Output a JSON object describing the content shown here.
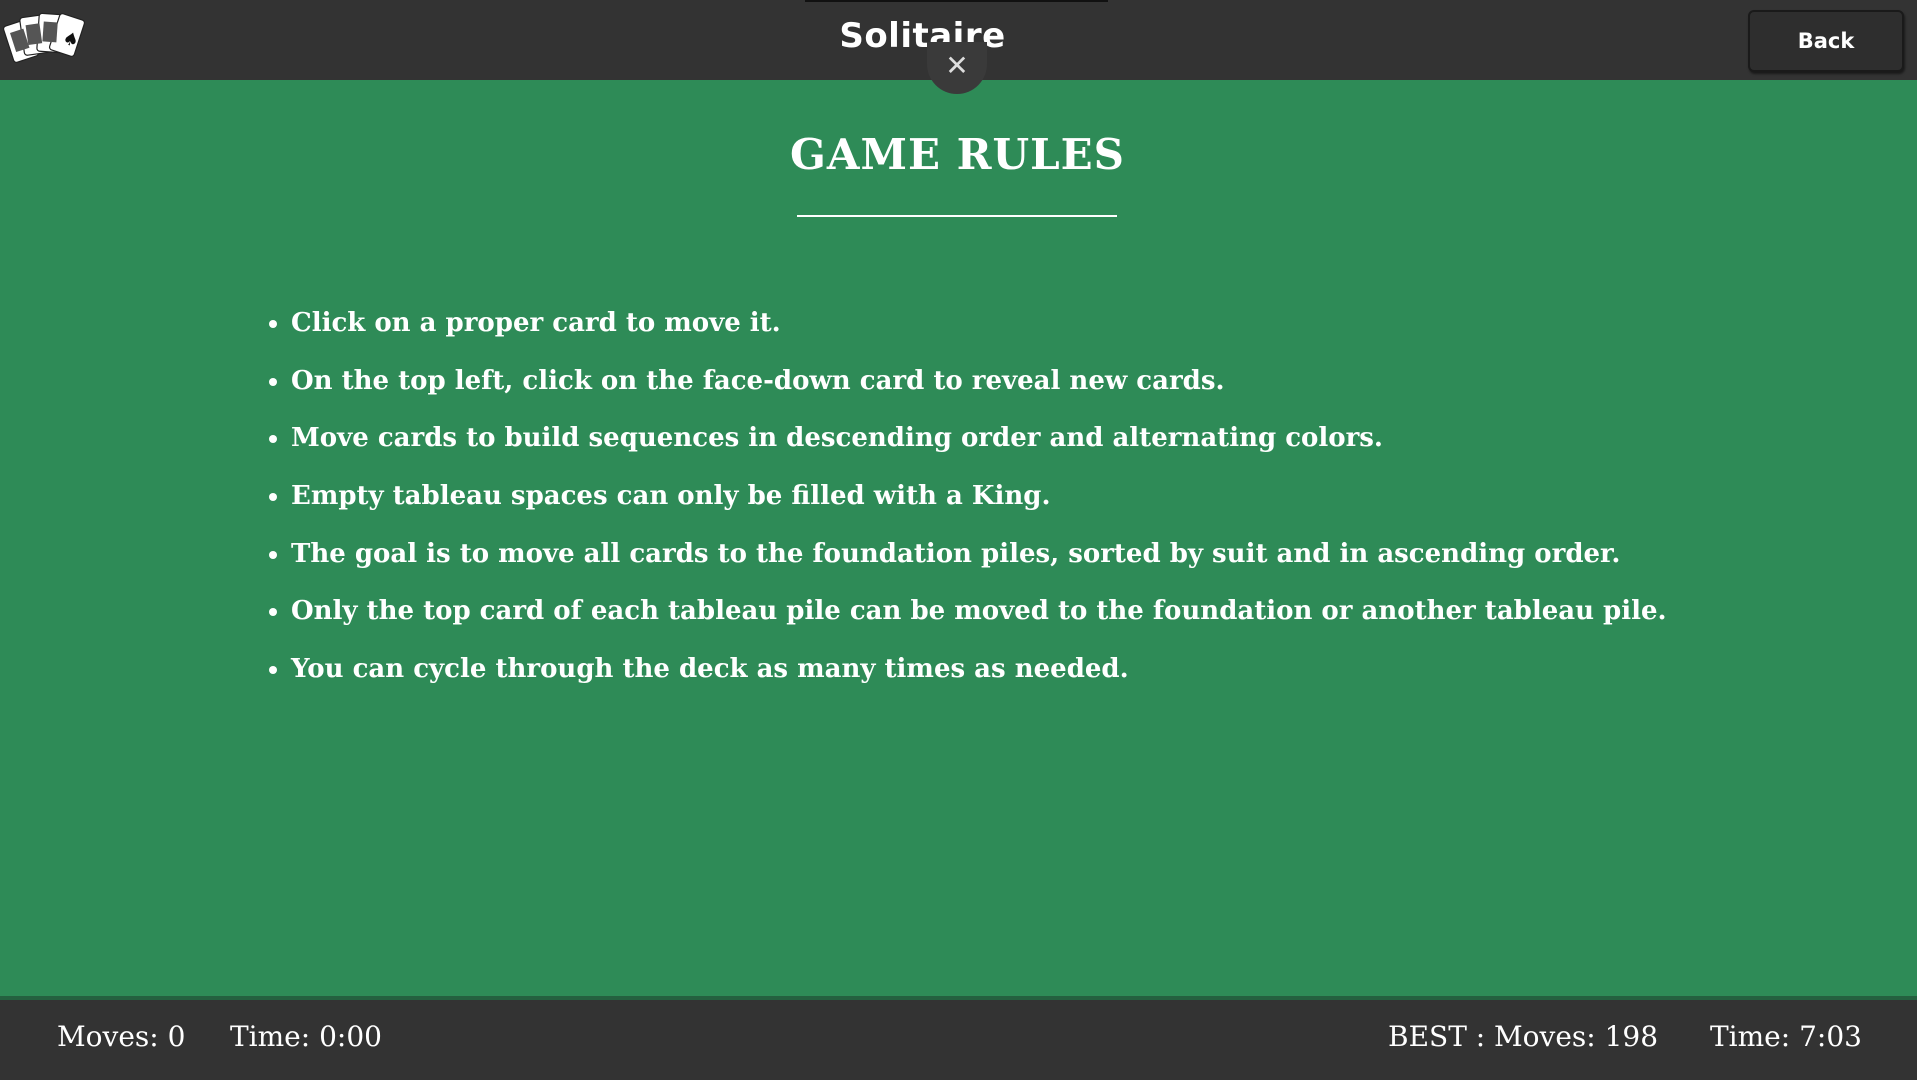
{
  "header": {
    "app_title": "Solitaire",
    "back_label": "Back",
    "close_symbol": "✕",
    "logo_icon": "playing-cards-fan-icon"
  },
  "rules": {
    "title": "GAME RULES",
    "items": [
      "Click on a proper card to move it.",
      "On the top left, click on the face-down card to reveal new cards.",
      "Move cards to build sequences in descending order and alternating colors.",
      "Empty tableau spaces can only be filled with a King.",
      "The goal is to move all cards to the foundation piles, sorted by suit and in ascending order.",
      "Only the top card of each tableau pile can be moved to the foundation or another tableau pile.",
      "You can cycle through the deck as many times as needed."
    ]
  },
  "footer": {
    "moves": "Moves: 0",
    "time": "Time: 0:00",
    "best_label": "BEST :",
    "best_moves": "Moves: 198",
    "best_time": "Time: 7:03"
  },
  "colors": {
    "table_green": "#2e8b57",
    "bar_dark": "#333333",
    "text": "#ffffff"
  }
}
